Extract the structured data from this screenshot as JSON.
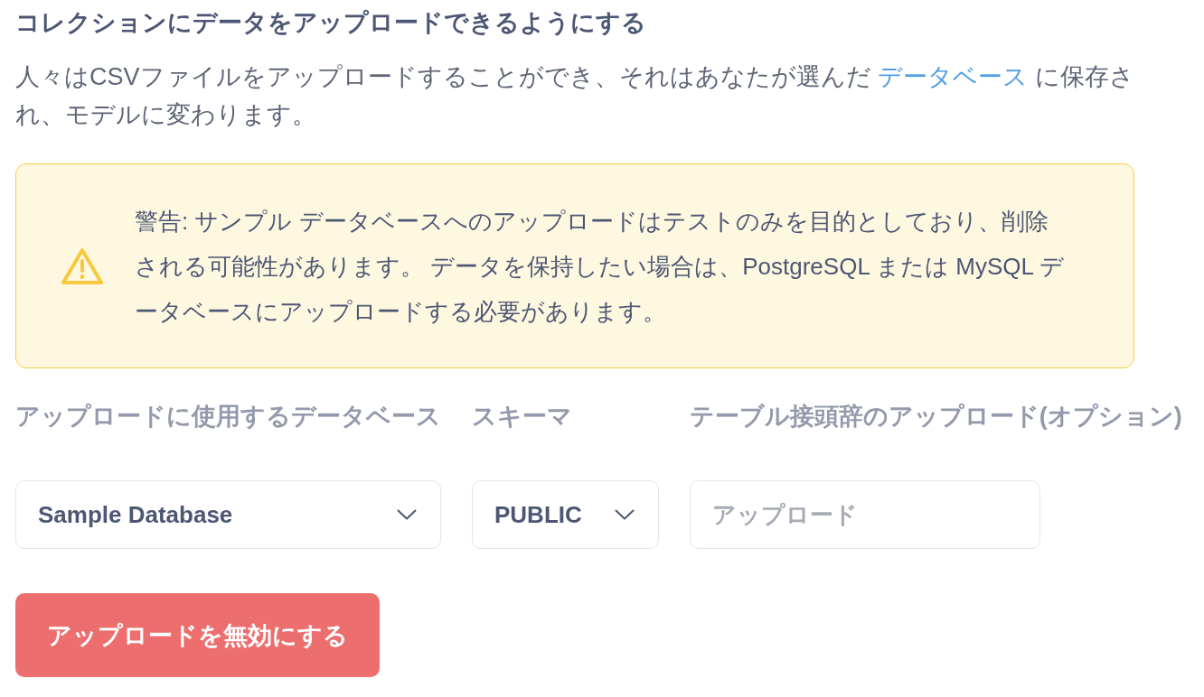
{
  "header": {
    "title": "コレクションにデータをアップロードできるようにする",
    "description": [
      {
        "kind": "text",
        "text": "人々はCSVファイルをアップロードすることができ、それはあなたが選んだ "
      },
      {
        "kind": "link",
        "text": "データベース"
      },
      {
        "kind": "text",
        "text": " に保存され、モデルに変わります。"
      }
    ]
  },
  "warning": {
    "message": "警告: サンプル データベースへのアップロードはテストのみを目的としており、削除される可能性があります。 データを保持したい場合は、PostgreSQL または MySQL データベースにアップロードする必要があります。"
  },
  "fields": [
    {
      "kind": "select",
      "label": "アップロードに使用するデータベース",
      "value": "Sample Database"
    },
    {
      "kind": "select",
      "label": "スキーマ",
      "value": "PUBLIC"
    },
    {
      "kind": "input",
      "label": "テーブル接頭辞のアップロード(オプション)",
      "placeholder": "アップロード"
    }
  ],
  "button": {
    "label": "アップロードを無効にする"
  }
}
